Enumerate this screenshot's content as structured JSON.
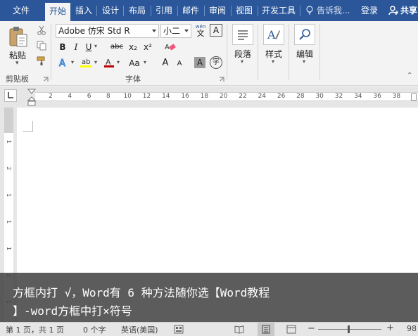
{
  "tabs": [
    {
      "label": "文件",
      "active": false
    },
    {
      "label": "开始",
      "active": true
    },
    {
      "label": "插入",
      "active": false
    },
    {
      "label": "设计",
      "active": false
    },
    {
      "label": "布局",
      "active": false
    },
    {
      "label": "引用",
      "active": false
    },
    {
      "label": "邮件",
      "active": false
    },
    {
      "label": "审阅",
      "active": false
    },
    {
      "label": "视图",
      "active": false
    },
    {
      "label": "开发工具",
      "active": false
    }
  ],
  "tell_me": "告诉我...",
  "login": "登录",
  "share": "共享",
  "ribbon": {
    "clipboard": {
      "paste_label": "粘贴",
      "group_label": "剪贴板"
    },
    "font": {
      "font_name": "Adobe 仿宋 Std R",
      "font_size": "小二",
      "group_label": "字体",
      "wen_glyph": "wén",
      "wen_char": "文",
      "boxed_a": "A",
      "bold": "B",
      "italic": "I",
      "underline": "U",
      "strike": "abc",
      "subscript": "x₂",
      "superscript": "x²",
      "grow": "A",
      "shrink": "A",
      "case": "Aa",
      "shade_a": "A",
      "circle_char": "字"
    },
    "paragraph": {
      "label": "段落"
    },
    "styles": {
      "label": "样式"
    },
    "editing": {
      "label": "编辑"
    }
  },
  "ruler": {
    "labels": [
      "2",
      "4",
      "6",
      "8",
      "10",
      "12",
      "14",
      "16",
      "18",
      "20",
      "22",
      "24",
      "26",
      "28",
      "30",
      "32",
      "34",
      "36",
      "38"
    ],
    "vlabels": [
      "1",
      "2",
      "1",
      "1",
      "1",
      "1",
      "1"
    ]
  },
  "caption": {
    "line1": "方框内打 √，Word有 6 种方法随你选【Word教程",
    "line2": "】-word方框中打×符号"
  },
  "status": {
    "page": "第 1 页，共 1 页",
    "words": "0 个字",
    "lang": "英语(美国)",
    "zoom": "98"
  },
  "colors": {
    "accent": "#2b579a",
    "highlight": "#ffff00",
    "font_red": "#c00000"
  }
}
